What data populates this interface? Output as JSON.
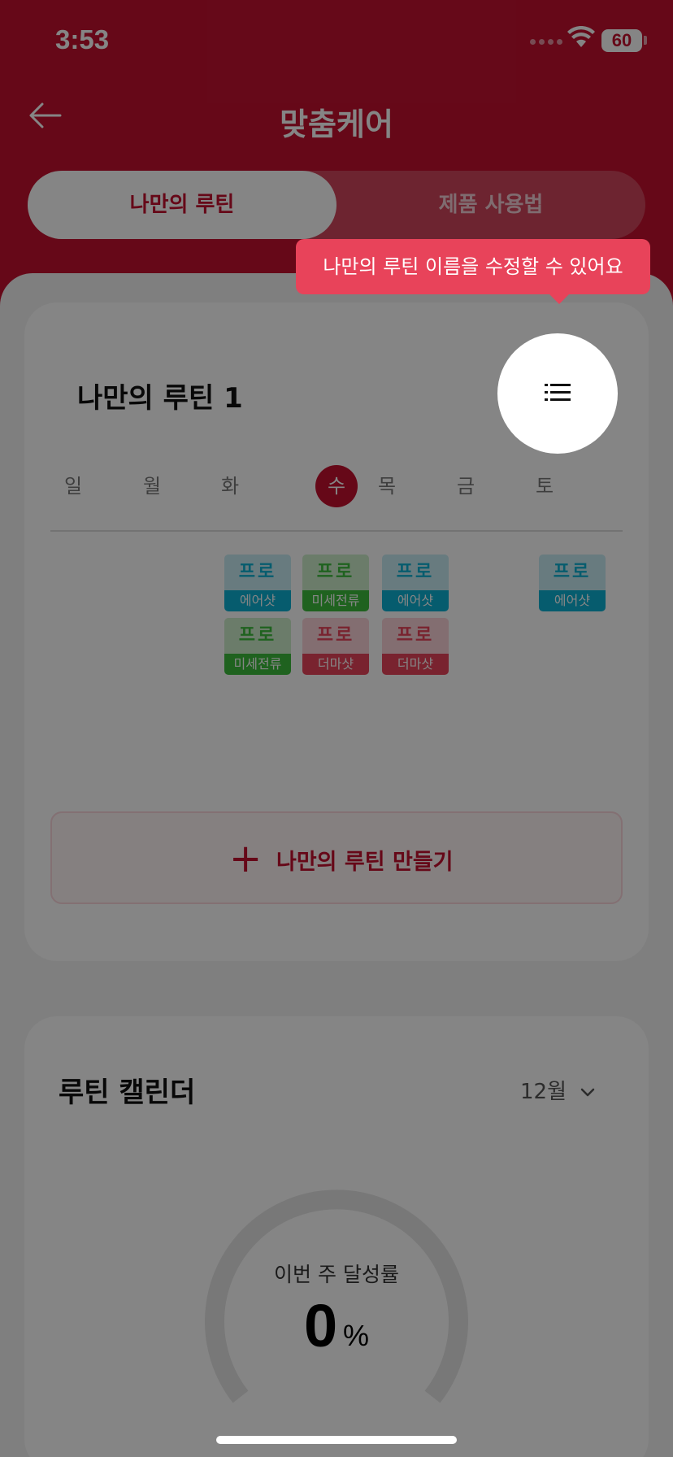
{
  "status_bar": {
    "time": "3:53",
    "battery": "60"
  },
  "header": {
    "title": "맞춤케어"
  },
  "tabs": [
    {
      "label": "나만의 루틴",
      "active": true
    },
    {
      "label": "제품 사용법",
      "active": false
    }
  ],
  "tooltip": {
    "text": "나만의 루틴 이름을 수정할 수 있어요"
  },
  "routine": {
    "title": "나만의 루틴 1",
    "days": [
      "일",
      "월",
      "화",
      "수",
      "목",
      "금",
      "토"
    ],
    "active_day_index": 3,
    "chips": [
      {
        "top": "프로",
        "bottom": "에어샷",
        "color": "blue"
      },
      {
        "top": "프로",
        "bottom": "미세전류",
        "color": "green"
      },
      {
        "top": "프로",
        "bottom": "미세전류",
        "color": "green"
      },
      {
        "top": "프로",
        "bottom": "더마샷",
        "color": "red"
      },
      {
        "top": "프로",
        "bottom": "에어샷",
        "color": "blue"
      },
      {
        "top": "프로",
        "bottom": "더마샷",
        "color": "red"
      },
      {
        "top": "프로",
        "bottom": "에어샷",
        "color": "blue"
      }
    ],
    "make_button": {
      "plus": "+",
      "label": "나만의 루틴 만들기"
    }
  },
  "calendar": {
    "title": "루틴 캘린더",
    "month": "12월",
    "gauge_label": "이번 주 달성률",
    "gauge_value": "0",
    "gauge_unit": "%"
  },
  "colors": {
    "brand": "#c4112f",
    "tooltip": "#e8435a",
    "blue": "#0cb1d3",
    "green": "#3dbd3d",
    "red": "#e8435a"
  }
}
